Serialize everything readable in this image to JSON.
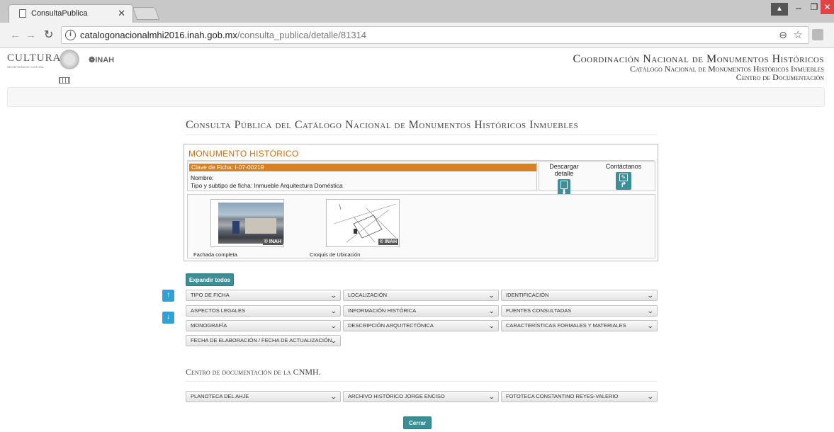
{
  "browser": {
    "tab_title": "ConsultaPublica",
    "url_host": "catalogonacionalmhi2016.inah.gob.mx",
    "url_path": "/consulta_publica/detalle/81314"
  },
  "header": {
    "logo_cultura": "CULTURA",
    "logo_cultura_sub": "SECRETARÍA DE CULTURA",
    "logo_inah": "INAH",
    "org_line1": "Coordinación Nacional de Monumentos Históricos",
    "org_line2": "Catálogo Nacional de Monumentos Históricos Inmuebles",
    "org_line3": "Centro de Documentación"
  },
  "main": {
    "page_heading": "Consulta Pública del Catálogo Nacional de Monumentos Históricos Inmuebles",
    "panel_title": "MONUMENTO HISTÓRICO",
    "clave": "Clave de Ficha: I-07-00219",
    "nombre": "Nombre:",
    "tipo_label": "Tipo y subtipo de ficha:",
    "tipo_value": "Inmueble Arquitectura Doméstica",
    "download_label": "Descargar detalle",
    "contact_label": "Contáctanos",
    "watermark": "© INAH",
    "images": [
      {
        "caption": "Fachada completa."
      },
      {
        "caption": "Croquis de Ubicación"
      }
    ],
    "expand_all": "Expandir todos",
    "sections_row1": [
      "TIPO DE FICHA",
      "LOCALIZACIÓN",
      "IDENTIFICACIÓN"
    ],
    "sections_row2": [
      "ASPECTOS LEGALES",
      "INFORMACIÓN HISTÓRICA",
      "FUENTES CONSULTADAS"
    ],
    "sections_row3": [
      "MONOGRAFÍA",
      "DESCRIPCIÓN ARQUITECTÓNICA",
      "CARACTERÍSTICAS FORMALES Y MATERIALES"
    ],
    "sections_row4": [
      "FECHA DE ELABORACIÓN / FECHA DE ACTUALIZACIÓN"
    ],
    "doc_heading": "Centro de documentación de la CNMH.",
    "doc_sections": [
      "PLANOTECA DEL AHJE",
      "ARCHIVO HISTÓRICO JORGE ENCISO",
      "FOTOTECA CONSTANTINO REYES-VALERIO"
    ],
    "close_label": "Cerrar"
  }
}
